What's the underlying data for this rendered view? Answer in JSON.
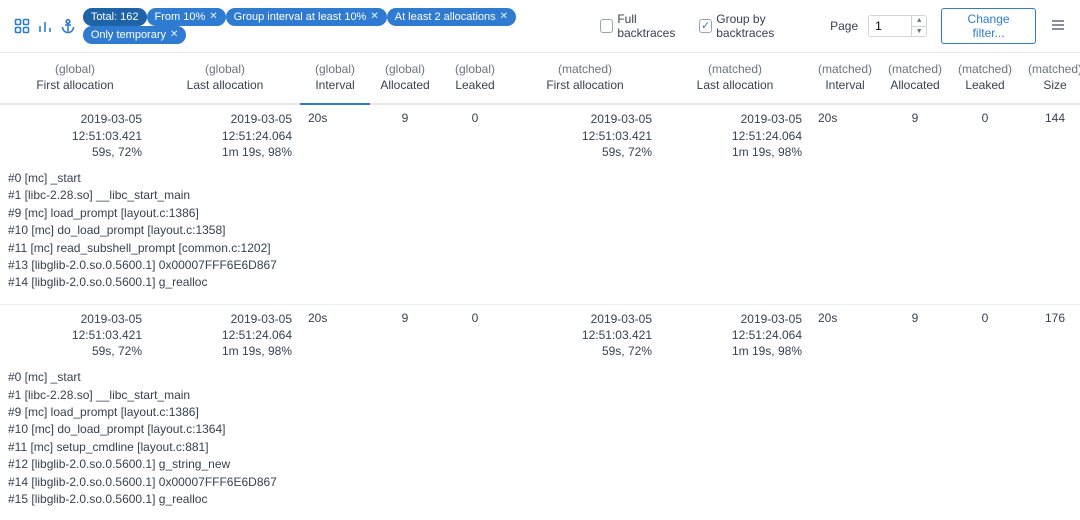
{
  "toolbar": {
    "pills": [
      {
        "label": "Total: 162",
        "closable": false
      },
      {
        "label": "From 10%",
        "closable": true
      },
      {
        "label": "Group interval at least 10%",
        "closable": true
      },
      {
        "label": "At least 2 allocations",
        "closable": true
      },
      {
        "label": "Only temporary",
        "closable": true
      }
    ],
    "full_backtraces_label": "Full backtraces",
    "full_backtraces_checked": false,
    "group_by_backtraces_label": "Group by backtraces",
    "group_by_backtraces_checked": true,
    "page_label": "Page",
    "page_value": "1",
    "change_filter_label": "Change filter..."
  },
  "headers": [
    {
      "group": "(global)",
      "name": "First allocation",
      "key": "g_first"
    },
    {
      "group": "(global)",
      "name": "Last allocation",
      "key": "g_last"
    },
    {
      "group": "(global)",
      "name": "Interval",
      "key": "g_interval",
      "sorted": true
    },
    {
      "group": "(global)",
      "name": "Allocated",
      "key": "g_alloc"
    },
    {
      "group": "(global)",
      "name": "Leaked",
      "key": "g_leak"
    },
    {
      "group": "(matched)",
      "name": "First allocation",
      "key": "m_first"
    },
    {
      "group": "(matched)",
      "name": "Last allocation",
      "key": "m_last"
    },
    {
      "group": "(matched)",
      "name": "Interval",
      "key": "m_interval"
    },
    {
      "group": "(matched)",
      "name": "Allocated",
      "key": "m_alloc"
    },
    {
      "group": "(matched)",
      "name": "Leaked",
      "key": "m_leak"
    },
    {
      "group": "(matched)",
      "name": "Size",
      "key": "m_size"
    }
  ],
  "rows": [
    {
      "g_first": {
        "ts": "2019-03-05 12:51:03.421",
        "sub": "59s, 72%"
      },
      "g_last": {
        "ts": "2019-03-05 12:51:24.064",
        "sub": "1m 19s, 98%"
      },
      "g_interval": "20s",
      "g_alloc": "9",
      "g_leak": "0",
      "m_first": {
        "ts": "2019-03-05 12:51:03.421",
        "sub": "59s, 72%"
      },
      "m_last": {
        "ts": "2019-03-05 12:51:24.064",
        "sub": "1m 19s, 98%"
      },
      "m_interval": "20s",
      "m_alloc": "9",
      "m_leak": "0",
      "m_size": "144",
      "frames": [
        "#0 [mc] _start",
        "#1 [libc-2.28.so] __libc_start_main",
        "#9 [mc] load_prompt [layout.c:1386]",
        "#10 [mc] do_load_prompt [layout.c:1358]",
        "#11 [mc] read_subshell_prompt [common.c:1202]",
        "#13 [libglib-2.0.so.0.5600.1] 0x00007FFF6E6D867",
        "#14 [libglib-2.0.so.0.5600.1] g_realloc"
      ]
    },
    {
      "g_first": {
        "ts": "2019-03-05 12:51:03.421",
        "sub": "59s, 72%"
      },
      "g_last": {
        "ts": "2019-03-05 12:51:24.064",
        "sub": "1m 19s, 98%"
      },
      "g_interval": "20s",
      "g_alloc": "9",
      "g_leak": "0",
      "m_first": {
        "ts": "2019-03-05 12:51:03.421",
        "sub": "59s, 72%"
      },
      "m_last": {
        "ts": "2019-03-05 12:51:24.064",
        "sub": "1m 19s, 98%"
      },
      "m_interval": "20s",
      "m_alloc": "9",
      "m_leak": "0",
      "m_size": "176",
      "frames": [
        "#0 [mc] _start",
        "#1 [libc-2.28.so] __libc_start_main",
        "#9 [mc] load_prompt [layout.c:1386]",
        "#10 [mc] do_load_prompt [layout.c:1364]",
        "#11 [mc] setup_cmdline [layout.c:881]",
        "#12 [libglib-2.0.so.0.5600.1] g_string_new",
        "#14 [libglib-2.0.so.0.5600.1] 0x00007FFF6E6D867",
        "#15 [libglib-2.0.so.0.5600.1] g_realloc"
      ]
    }
  ],
  "colors": {
    "accent": "#2f7bd1"
  }
}
